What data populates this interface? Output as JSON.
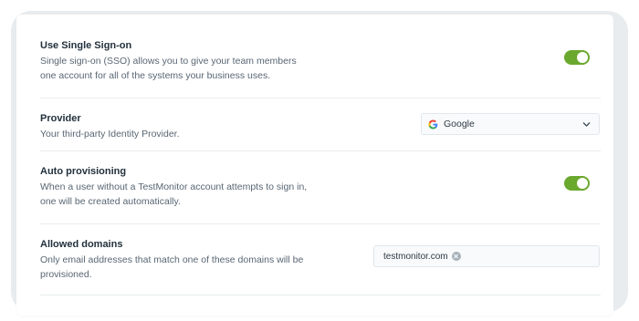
{
  "settings": {
    "sso": {
      "title": "Use Single Sign-on",
      "description": "Single sign-on (SSO) allows you to give your team members one account for all of the systems your business uses.",
      "enabled": true
    },
    "provider": {
      "title": "Provider",
      "description": "Your third-party Identity Provider.",
      "selected": "Google",
      "icon": "google-logo-icon"
    },
    "auto_provisioning": {
      "title": "Auto provisioning",
      "description": "When a user without a TestMonitor account attempts to sign in, one will be created automatically.",
      "enabled": true
    },
    "allowed_domains": {
      "title": "Allowed domains",
      "description": "Only email addresses that match one of these domains will be provisioned.",
      "domains": [
        "testmonitor.com"
      ]
    }
  },
  "colors": {
    "toggle_on": "#6aa82e",
    "frame_bg": "#e8ecef"
  }
}
